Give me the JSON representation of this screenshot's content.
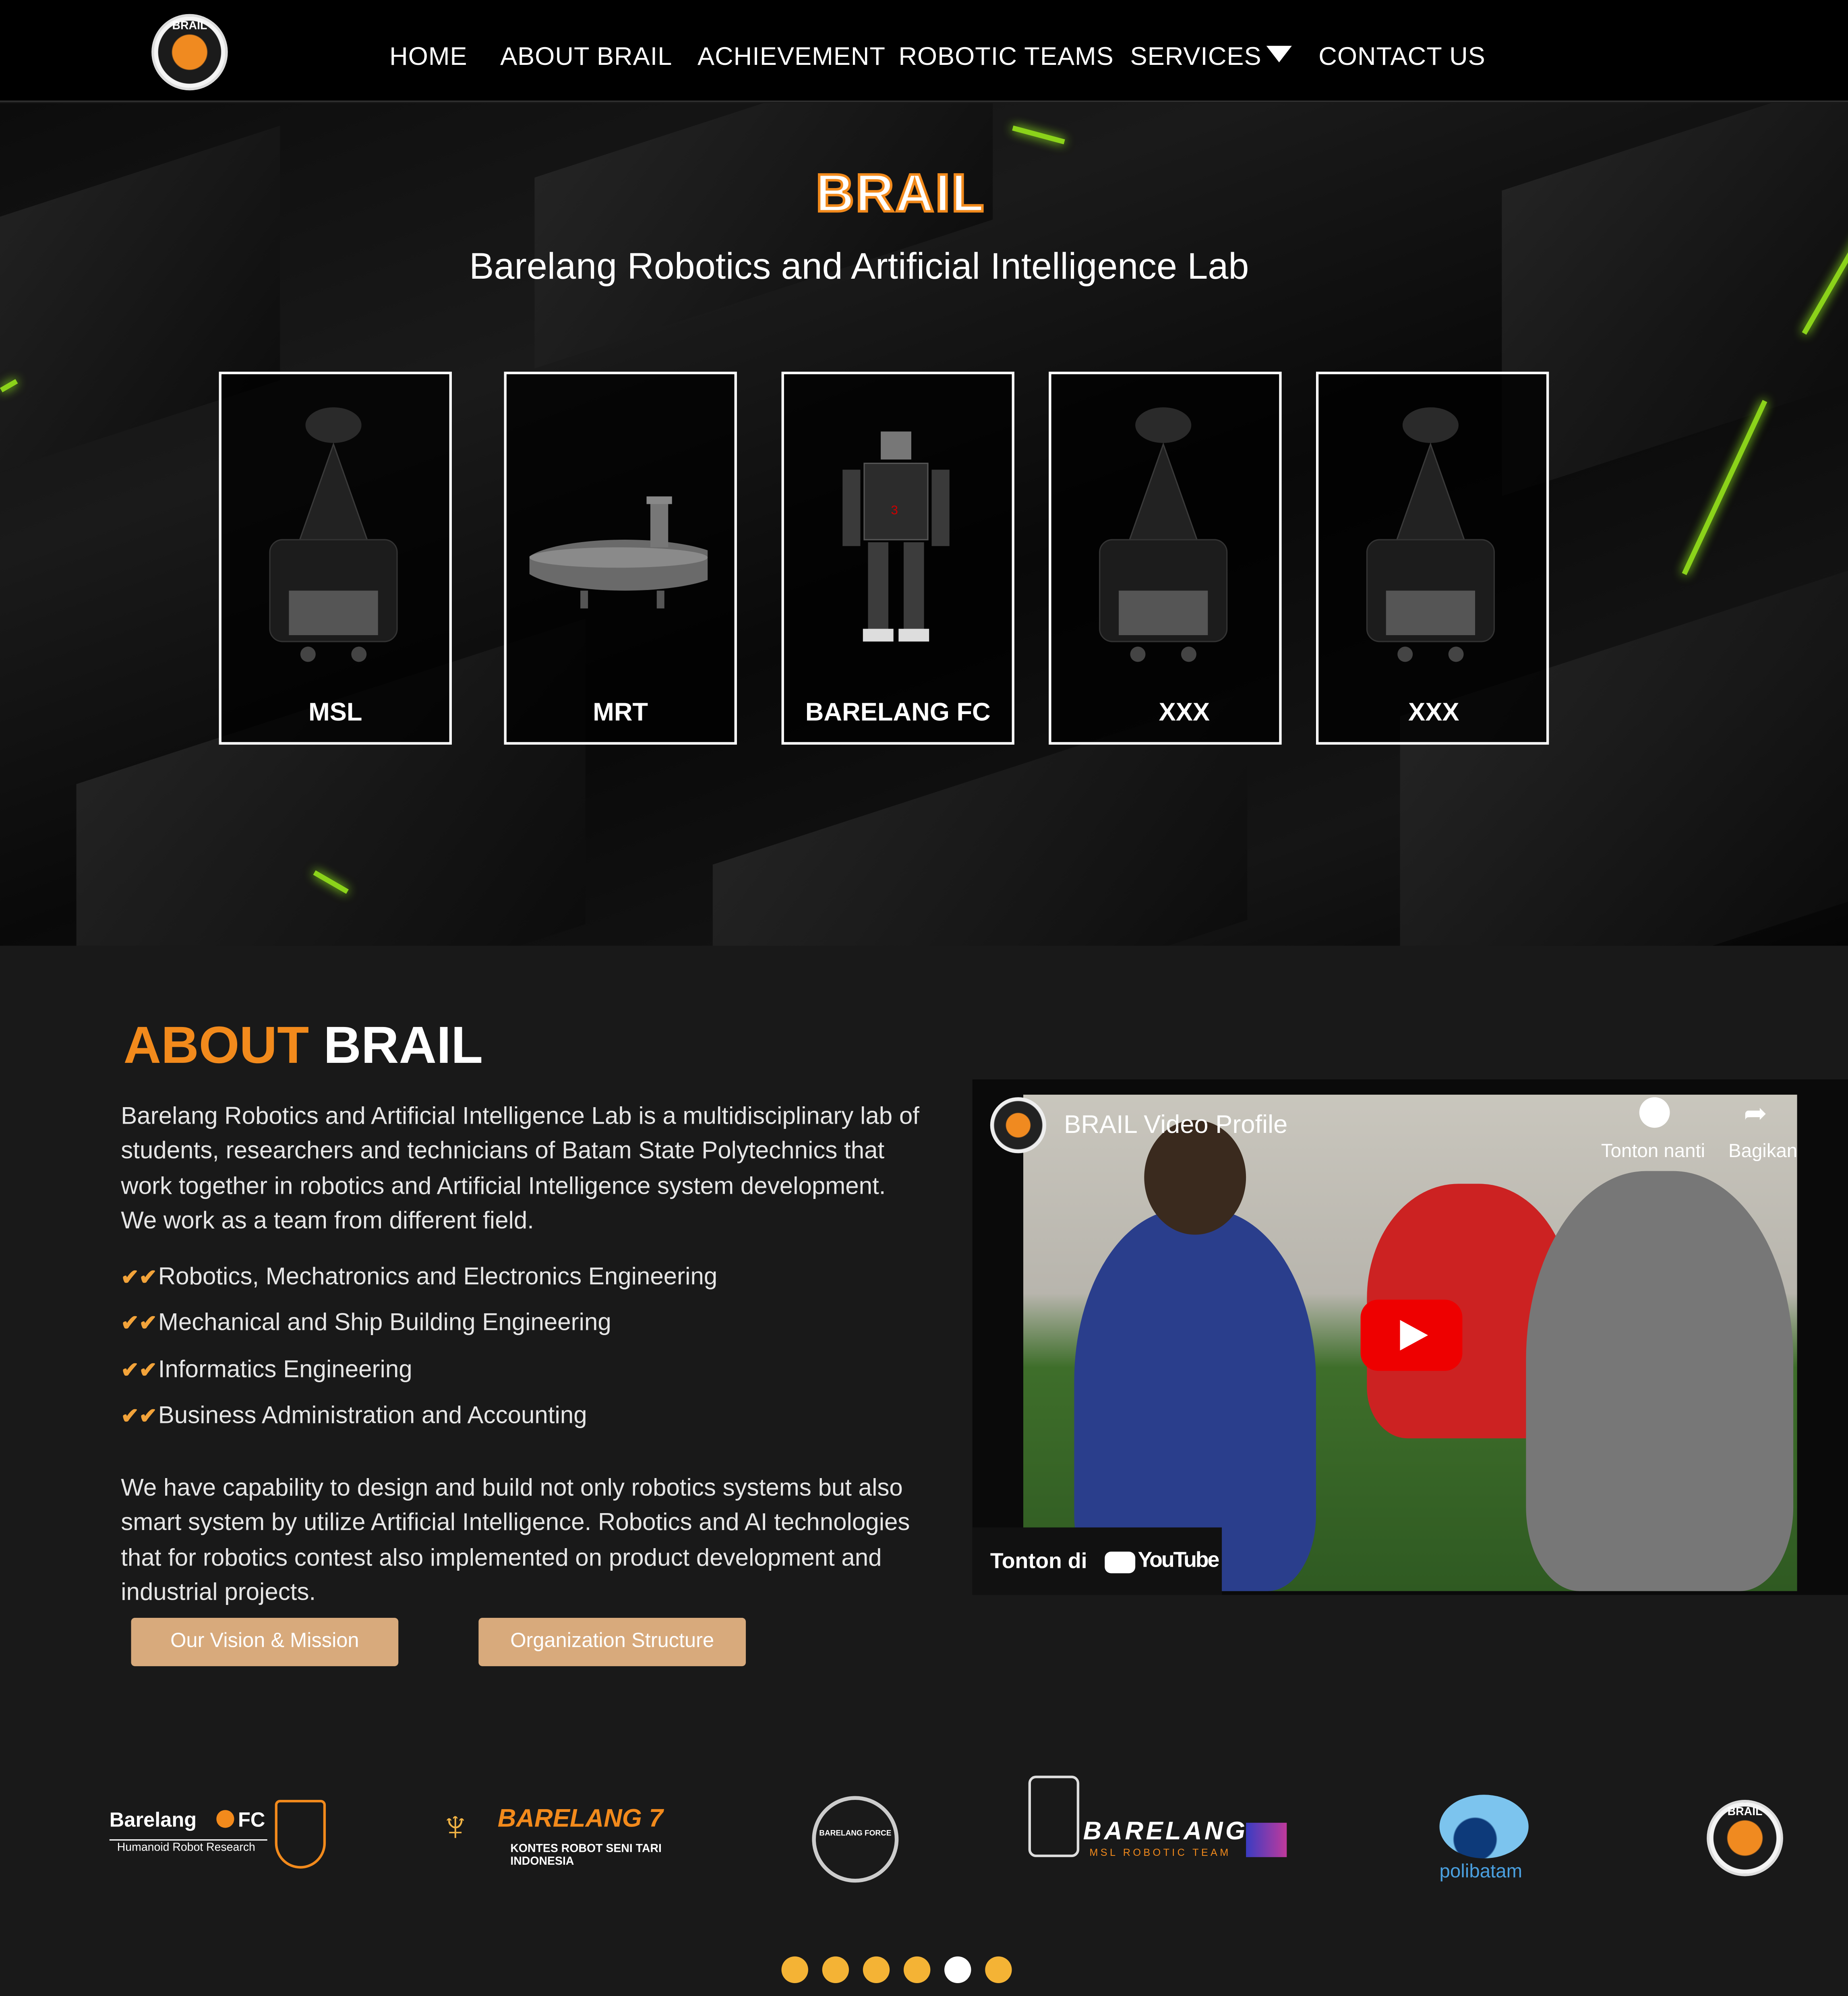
{
  "nav": {
    "logo_text": "BRAIL",
    "items": [
      {
        "label": "HOME"
      },
      {
        "label": "ABOUT BRAIL"
      },
      {
        "label": "ACHIEVEMENT"
      },
      {
        "label": "ROBOTIC TEAMS"
      },
      {
        "label": "SERVICES"
      },
      {
        "label": "CONTACT US"
      }
    ]
  },
  "hero": {
    "title": "BRAIL",
    "subtitle": "Barelang Robotics and Artificial Intelligence Lab",
    "cards": [
      {
        "label": "MSL",
        "image": "msl-robot"
      },
      {
        "label": "MRT",
        "image": "submarine"
      },
      {
        "label": "BARELANG FC",
        "image": "humanoid-robot"
      },
      {
        "label": "XXX",
        "image": "msl-robot"
      },
      {
        "label": "XXX",
        "image": "msl-robot"
      }
    ]
  },
  "about": {
    "heading_accent": "ABOUT",
    "heading_rest": "BRAIL",
    "intro": "Barelang Robotics and Artificial Intelligence Lab is a multidisciplinary lab of students, researchers and technicians of Batam State Polytechnics that work together in robotics and Artificial Intelligence system development. We work as a team from different field.",
    "fields": [
      "Robotics, Mechatronics and Electronics Engineering",
      "Mechanical and Ship Building Engineering",
      "Informatics Engineering",
      "Business Administration and Accounting"
    ],
    "capability": "We have capability to design and build not only robotics systems but also smart system by utilize Artificial Intelligence. Robotics and AI technologies that for robotics contest also implemented on product development and industrial projects.",
    "buttons": {
      "vision": "Our Vision & Mission",
      "org": "Organization Structure"
    }
  },
  "video": {
    "title": "BRAIL Video Profile",
    "watch_later": "Tonton nanti",
    "share": "Bagikan",
    "watch_on": "Tonton di",
    "platform": "YouTube"
  },
  "partners": {
    "fc": {
      "name": "Barelang",
      "suffix": "FC",
      "tagline": "Humanoid Robot Research"
    },
    "seven": {
      "name": "BARELANG 7",
      "tagline": "KONTES ROBOT SENI TARI INDONESIA"
    },
    "force": {
      "name": "BARELANG FORCE"
    },
    "msl": {
      "name": "BARELANG",
      "tagline": "MSL ROBOTIC TEAM"
    },
    "polibatam": {
      "name": "polibatam"
    },
    "brail": {
      "name": "BRAIL"
    }
  },
  "carousel": {
    "count": 6,
    "active": 5
  },
  "colors": {
    "accent": "#f28a1c",
    "button": "#d8aa7c",
    "background": "#191919",
    "dot": "#f4b335"
  }
}
